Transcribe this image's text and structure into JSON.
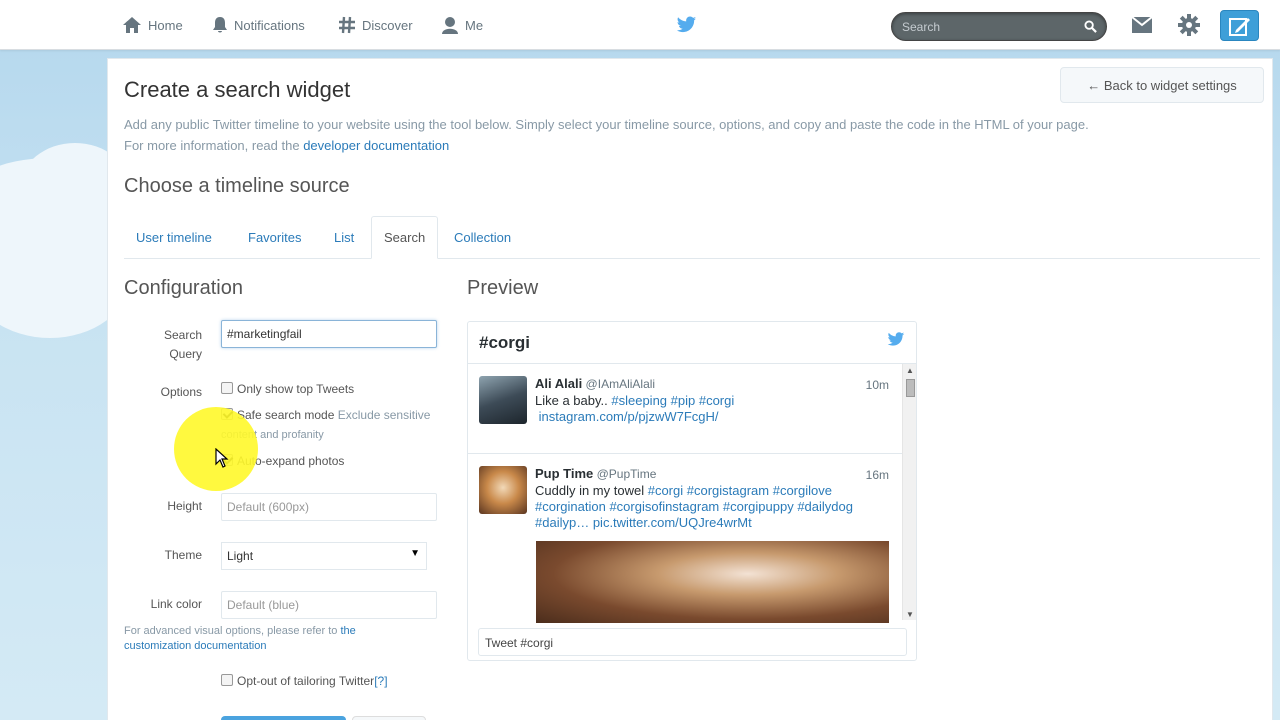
{
  "nav": {
    "home": "Home",
    "notifications": "Notifications",
    "discover": "Discover",
    "me": "Me",
    "search_placeholder": "Search"
  },
  "page": {
    "title": "Create a search widget",
    "back_button": "← Back to widget settings",
    "intro_line1": "Add any public Twitter timeline to your website using the tool below. Simply select your timeline source, options, and copy and paste the code in the HTML of your page.",
    "intro_line2_prefix": "For more information, read the ",
    "intro_link": "developer documentation",
    "timeline_source_title": "Choose a timeline source"
  },
  "tabs": [
    "User timeline",
    "Favorites",
    "List",
    "Search",
    "Collection"
  ],
  "active_tab": "Search",
  "config": {
    "title": "Configuration",
    "search_query_label_1": "Search",
    "search_query_label_2": "Query",
    "search_query_value": "#marketingfail",
    "options_label": "Options",
    "opt_top_tweets": "Only show top Tweets",
    "opt_safe_search": "Safe search mode",
    "opt_safe_search_desc_1": "Exclude sensitive",
    "opt_safe_search_desc_2": "content and profanity",
    "opt_auto_expand": "Auto-expand photos",
    "height_label": "Height",
    "height_placeholder": "Default (600px)",
    "theme_label": "Theme",
    "theme_value": "Light",
    "link_color_label": "Link color",
    "link_color_placeholder": "Default (blue)",
    "note_prefix": "For advanced visual options, please refer to ",
    "note_link": "the customization documentation",
    "opt_out_label": "Opt-out of tailoring Twitter ",
    "opt_out_help": "[?]"
  },
  "checkbox_state": {
    "top_tweets": false,
    "safe_search": true,
    "auto_expand": true,
    "opt_out": false
  },
  "preview": {
    "title": "Preview",
    "widget_title": "#corgi",
    "tweets": [
      {
        "name": "Ali Alali",
        "handle": "@IAmAliAlali",
        "time": "10m",
        "text_plain": "Like a baby.. ",
        "tags": "#sleeping #pip #corgi",
        "link": "instagram.com/p/pjzwW7FcgH/"
      },
      {
        "name": "Pup Time",
        "handle": "@PupTime",
        "time": "16m",
        "text_plain": "Cuddly in my towel  ",
        "tags": "#corgi #corgistagram #corgilove #corgination #corgisofinstagram #corgipuppy #dailydog #dailyp…",
        "link": "pic.twitter.com/UQJre4wrMt"
      }
    ],
    "tweet_box": "Tweet #corgi"
  },
  "colors": {
    "link": "#2b7bb9",
    "twitter_blue": "#55acee",
    "highlight": "#fff82a"
  }
}
